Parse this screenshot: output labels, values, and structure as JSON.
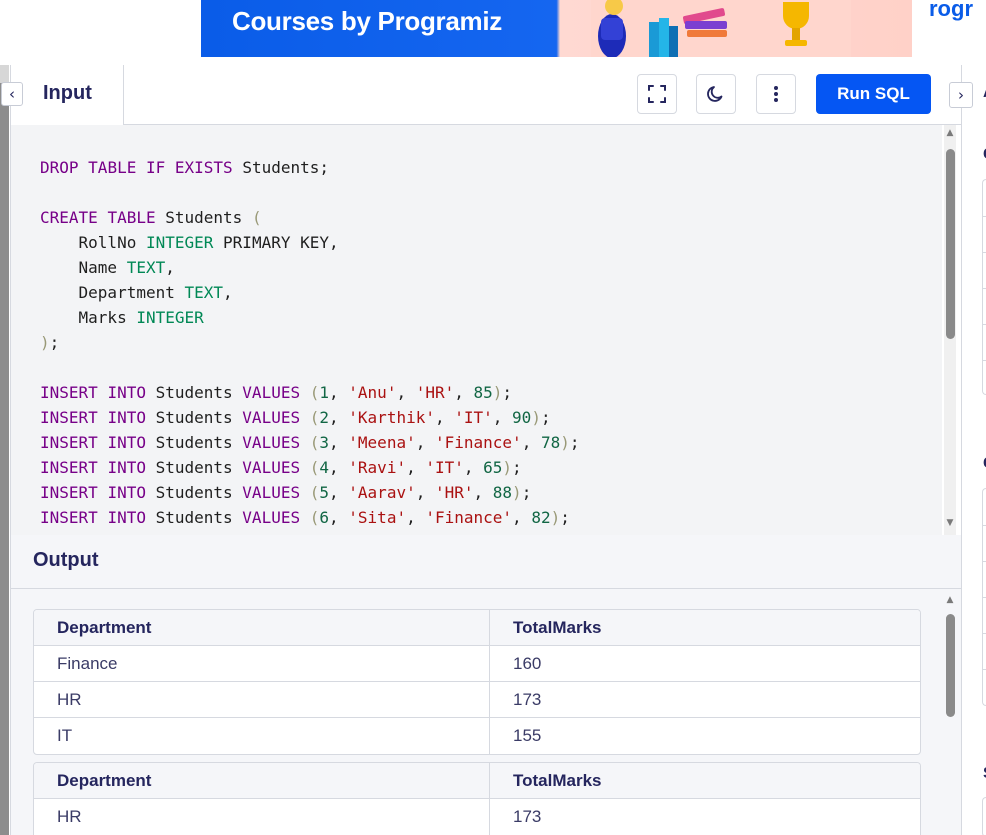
{
  "banner": {
    "text": "Courses by Programiz",
    "brand_peek": "rogr"
  },
  "toolbar": {
    "tab_label": "Input",
    "run_label": "Run SQL",
    "collapse_left_glyph": "‹",
    "collapse_right_glyph": "›",
    "icons": [
      "fullscreen-icon",
      "dark-mode-icon",
      "more-options-icon"
    ]
  },
  "editor": {
    "lines": [
      "DROP TABLE IF EXISTS Students;",
      "",
      "CREATE TABLE Students (",
      "    RollNo INTEGER PRIMARY KEY,",
      "    Name TEXT,",
      "    Department TEXT,",
      "    Marks INTEGER",
      ");",
      "",
      "INSERT INTO Students VALUES (1, 'Anu', 'HR', 85);",
      "INSERT INTO Students VALUES (2, 'Karthik', 'IT', 90);",
      "INSERT INTO Students VALUES (3, 'Meena', 'Finance', 78);",
      "INSERT INTO Students VALUES (4, 'Ravi', 'IT', 65);",
      "INSERT INTO Students VALUES (5, 'Aarav', 'HR', 88);",
      "INSERT INTO Students VALUES (6, 'Sita', 'Finance', 82);"
    ]
  },
  "output": {
    "title": "Output",
    "tables": [
      {
        "columns": [
          "Department",
          "TotalMarks"
        ],
        "rows": [
          [
            "Finance",
            "160"
          ],
          [
            "HR",
            "173"
          ],
          [
            "IT",
            "155"
          ]
        ]
      },
      {
        "columns": [
          "Department",
          "TotalMarks"
        ],
        "rows": [
          [
            "HR",
            "173"
          ]
        ]
      }
    ]
  },
  "right_panel": {
    "letters": [
      "A",
      "C",
      "C",
      "S"
    ]
  },
  "colors": {
    "accent": "#0556f3",
    "keyword": "#770088",
    "type": "#008855",
    "string": "#aa1111",
    "number": "#116644"
  }
}
